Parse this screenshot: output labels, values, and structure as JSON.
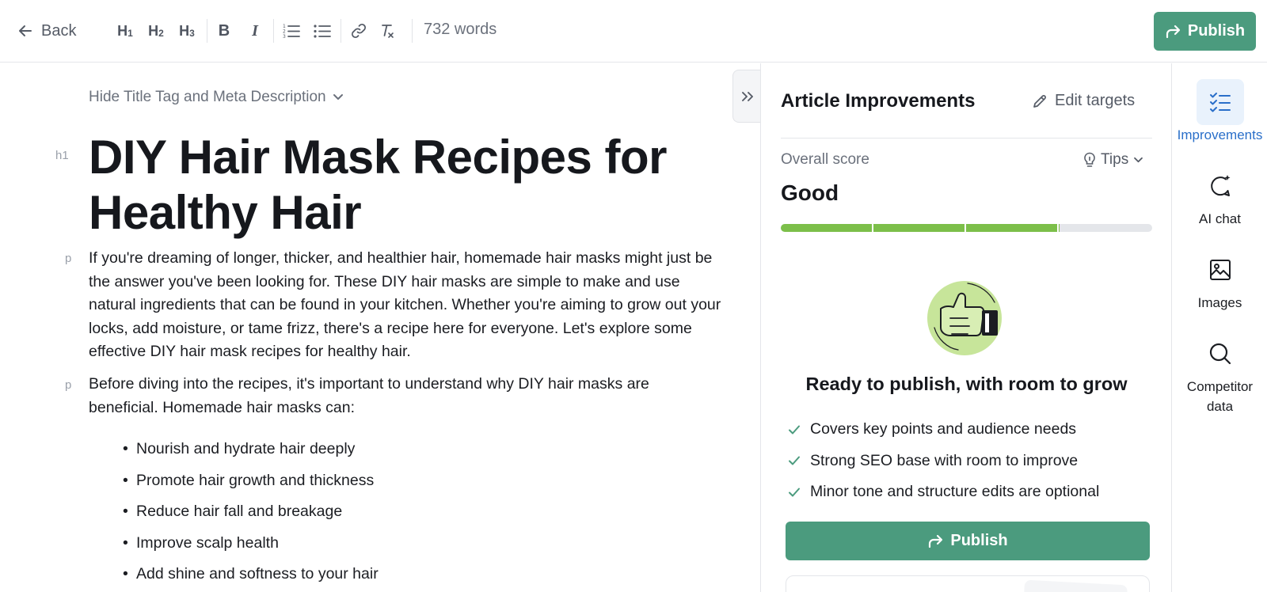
{
  "toolbar": {
    "back_label": "Back",
    "h1_label": "H",
    "h1_sub": "1",
    "h2_label": "H",
    "h2_sub": "2",
    "h3_label": "H",
    "h3_sub": "3",
    "bold_label": "B",
    "italic_label": "I",
    "word_count": "732 words",
    "publish_label": "Publish",
    "accent": "#4b9b7e"
  },
  "editor": {
    "meta_toggle": "Hide Title Tag and Meta Description",
    "h1_tag": "h1",
    "p_tag": "p",
    "title": "DIY Hair Mask Recipes for Healthy Hair",
    "paragraph1": "If you're dreaming of longer, thicker, and healthier hair, homemade hair masks might just be the answer you've been looking for. These DIY hair masks are simple to make and use natural ingredients that can be found in your kitchen. Whether you're aiming to grow out your locks, add moisture, or tame frizz, there's a recipe here for everyone. Let's explore some effective DIY hair mask recipes for healthy hair.",
    "paragraph2": "Before diving into the recipes, it's important to understand why DIY hair masks are beneficial. Homemade hair masks can:",
    "bullets": [
      "Nourish and hydrate hair deeply",
      "Promote hair growth and thickness",
      "Reduce hair fall and breakage",
      "Improve scalp health",
      "Add shine and softness to your hair"
    ]
  },
  "panel": {
    "title": "Article Improvements",
    "edit_targets": "Edit targets",
    "score_label": "Overall score",
    "tips_label": "Tips",
    "score_value": "Good",
    "score_progress": 0.75,
    "ready_title": "Ready to publish, with room to grow",
    "checks": [
      "Covers key points and audience needs",
      "Strong SEO base with room to improve",
      "Minor tone and structure edits are optional"
    ],
    "publish_label": "Publish",
    "score_color": "#7cbf4a"
  },
  "rail": {
    "improvements": "Improvements",
    "ai_chat": "AI chat",
    "images": "Images",
    "competitor_line1": "Competitor",
    "competitor_line2": "data",
    "active_color": "#2a6fc9"
  }
}
